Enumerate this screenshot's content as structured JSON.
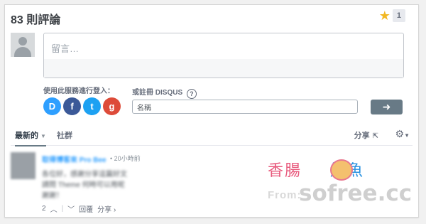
{
  "header": {
    "comment_count_title": "83 則評論",
    "favorite_count": "1"
  },
  "compose": {
    "placeholder": "留言…"
  },
  "login": {
    "services_label": "使用此服務進行登入：",
    "services": [
      "D",
      "f",
      "t",
      "g"
    ],
    "register_label": "或註冊 DISQUS",
    "help_glyph": "?",
    "name_placeholder": "名稱",
    "submit_glyph": "➜"
  },
  "tabs": {
    "latest": "最新的",
    "community": "社群",
    "share": "分享",
    "settings_glyph": "⚙"
  },
  "comment": {
    "author": "取得博客來 Pro Bee",
    "time": "• 20小時前",
    "lines": [
      "各位好，感謝分享這篇好文",
      "請問 Theme 何時可以用呢",
      "謝謝！"
    ],
    "votes": "2",
    "reply": "回覆",
    "share": "分享 ›"
  },
  "watermark": {
    "line1_a": "香腸",
    "line1_b": "魷魚",
    "from": "From:",
    "site": "sofree.cc"
  },
  "colors": {
    "accent_blue": "#2e9fff",
    "star": "#f2b824",
    "button": "#687a86"
  }
}
